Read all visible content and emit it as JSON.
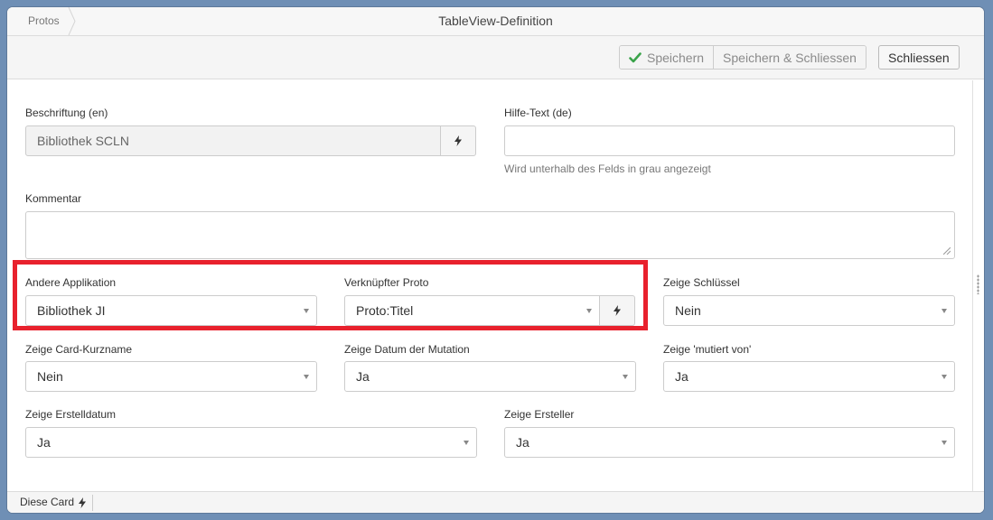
{
  "breadcrumb": "Protos",
  "title": "TableView-Definition",
  "toolbar": {
    "save": "Speichern",
    "save_close": "Speichern & Schliessen",
    "close": "Schliessen"
  },
  "form": {
    "beschriftung": {
      "label": "Beschriftung (en)",
      "value": "Bibliothek SCLN",
      "icon": "bolt-icon"
    },
    "hilfetext": {
      "label": "Hilfe-Text (de)",
      "value": "",
      "hint": "Wird unterhalb des Felds in grau angezeigt"
    },
    "kommentar": {
      "label": "Kommentar",
      "value": ""
    },
    "andere_applikation": {
      "label": "Andere Applikation",
      "value": "Bibliothek JI"
    },
    "verknuepfter_proto": {
      "label": "Verknüpfter Proto",
      "value": "Proto:Titel",
      "icon": "bolt-icon"
    },
    "zeige_schluessel": {
      "label": "Zeige Schlüssel",
      "value": "Nein"
    },
    "zeige_card_kurzname": {
      "label": "Zeige Card-Kurzname",
      "value": "Nein"
    },
    "zeige_datum_mutation": {
      "label": "Zeige Datum der Mutation",
      "value": "Ja"
    },
    "zeige_mutiert_von": {
      "label": "Zeige 'mutiert von'",
      "value": "Ja"
    },
    "zeige_erstelldatum": {
      "label": "Zeige Erstelldatum",
      "value": "Ja"
    },
    "zeige_ersteller": {
      "label": "Zeige Ersteller",
      "value": "Ja"
    }
  },
  "statusbar": {
    "item": "Diese Card"
  },
  "colors": {
    "highlight": "#e8212d",
    "check": "#3aa34a",
    "background": "#6f8fb5"
  }
}
